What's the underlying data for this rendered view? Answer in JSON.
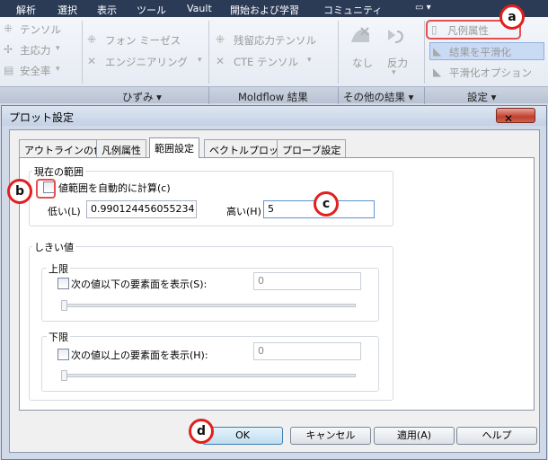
{
  "menu": [
    "解析",
    "選択",
    "表示",
    "ツール",
    "Vault",
    "開始および学習",
    "コミュニティ"
  ],
  "ribbon": {
    "col1": [
      "テンソル",
      "主応力",
      "安全率"
    ],
    "col2": [
      "フォン ミーゼス",
      "エンジニアリング"
    ],
    "col3": [
      "残留応力テンソル",
      "CTE テンソル"
    ],
    "nashi": "なし",
    "hanryoku": "反力",
    "legend_attr": "凡例属性",
    "smooth": "結果を平滑化",
    "smooth_opt": "平滑化オプション",
    "groups": [
      "ひずみ",
      "Moldflow 結果",
      "その他の結果",
      "設定"
    ]
  },
  "dialog": {
    "title": "プロット設定",
    "close": "✕",
    "tabs": [
      "アウトラインの色",
      "凡例属性",
      "範囲設定",
      "ベクトルプロット",
      "プローブ設定"
    ],
    "current_range": {
      "legend": "現在の範囲",
      "auto_label": "値範囲を自動的に計算(c)",
      "auto_checked": false,
      "low_label": "低い(L)",
      "low_value": "0.990124456055234",
      "high_label": "高い(H)",
      "high_value": "5"
    },
    "threshold": {
      "legend": "しきい値",
      "upper": {
        "legend": "上限",
        "label": "次の値以下の要素面を表示(S):",
        "value": "0",
        "checked": false
      },
      "lower": {
        "legend": "下限",
        "label": "次の値以上の要素面を表示(H):",
        "value": "0",
        "checked": false
      }
    },
    "buttons": {
      "ok": "OK",
      "cancel": "キャンセル",
      "apply": "適用(A)",
      "help": "ヘルプ"
    }
  },
  "callouts": {
    "a": "a",
    "b": "b",
    "c": "c",
    "d": "d"
  }
}
